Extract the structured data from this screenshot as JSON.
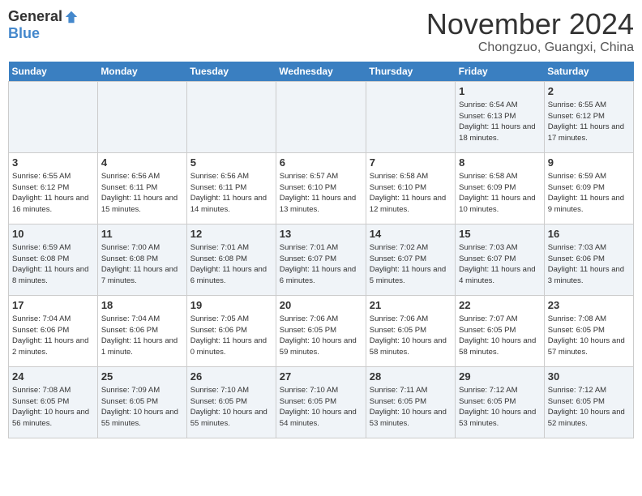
{
  "header": {
    "logo_general": "General",
    "logo_blue": "Blue",
    "month": "November 2024",
    "location": "Chongzuo, Guangxi, China"
  },
  "weekdays": [
    "Sunday",
    "Monday",
    "Tuesday",
    "Wednesday",
    "Thursday",
    "Friday",
    "Saturday"
  ],
  "weeks": [
    [
      {
        "day": "",
        "info": ""
      },
      {
        "day": "",
        "info": ""
      },
      {
        "day": "",
        "info": ""
      },
      {
        "day": "",
        "info": ""
      },
      {
        "day": "",
        "info": ""
      },
      {
        "day": "1",
        "info": "Sunrise: 6:54 AM\nSunset: 6:13 PM\nDaylight: 11 hours and 18 minutes."
      },
      {
        "day": "2",
        "info": "Sunrise: 6:55 AM\nSunset: 6:12 PM\nDaylight: 11 hours and 17 minutes."
      }
    ],
    [
      {
        "day": "3",
        "info": "Sunrise: 6:55 AM\nSunset: 6:12 PM\nDaylight: 11 hours and 16 minutes."
      },
      {
        "day": "4",
        "info": "Sunrise: 6:56 AM\nSunset: 6:11 PM\nDaylight: 11 hours and 15 minutes."
      },
      {
        "day": "5",
        "info": "Sunrise: 6:56 AM\nSunset: 6:11 PM\nDaylight: 11 hours and 14 minutes."
      },
      {
        "day": "6",
        "info": "Sunrise: 6:57 AM\nSunset: 6:10 PM\nDaylight: 11 hours and 13 minutes."
      },
      {
        "day": "7",
        "info": "Sunrise: 6:58 AM\nSunset: 6:10 PM\nDaylight: 11 hours and 12 minutes."
      },
      {
        "day": "8",
        "info": "Sunrise: 6:58 AM\nSunset: 6:09 PM\nDaylight: 11 hours and 10 minutes."
      },
      {
        "day": "9",
        "info": "Sunrise: 6:59 AM\nSunset: 6:09 PM\nDaylight: 11 hours and 9 minutes."
      }
    ],
    [
      {
        "day": "10",
        "info": "Sunrise: 6:59 AM\nSunset: 6:08 PM\nDaylight: 11 hours and 8 minutes."
      },
      {
        "day": "11",
        "info": "Sunrise: 7:00 AM\nSunset: 6:08 PM\nDaylight: 11 hours and 7 minutes."
      },
      {
        "day": "12",
        "info": "Sunrise: 7:01 AM\nSunset: 6:08 PM\nDaylight: 11 hours and 6 minutes."
      },
      {
        "day": "13",
        "info": "Sunrise: 7:01 AM\nSunset: 6:07 PM\nDaylight: 11 hours and 6 minutes."
      },
      {
        "day": "14",
        "info": "Sunrise: 7:02 AM\nSunset: 6:07 PM\nDaylight: 11 hours and 5 minutes."
      },
      {
        "day": "15",
        "info": "Sunrise: 7:03 AM\nSunset: 6:07 PM\nDaylight: 11 hours and 4 minutes."
      },
      {
        "day": "16",
        "info": "Sunrise: 7:03 AM\nSunset: 6:06 PM\nDaylight: 11 hours and 3 minutes."
      }
    ],
    [
      {
        "day": "17",
        "info": "Sunrise: 7:04 AM\nSunset: 6:06 PM\nDaylight: 11 hours and 2 minutes."
      },
      {
        "day": "18",
        "info": "Sunrise: 7:04 AM\nSunset: 6:06 PM\nDaylight: 11 hours and 1 minute."
      },
      {
        "day": "19",
        "info": "Sunrise: 7:05 AM\nSunset: 6:06 PM\nDaylight: 11 hours and 0 minutes."
      },
      {
        "day": "20",
        "info": "Sunrise: 7:06 AM\nSunset: 6:05 PM\nDaylight: 10 hours and 59 minutes."
      },
      {
        "day": "21",
        "info": "Sunrise: 7:06 AM\nSunset: 6:05 PM\nDaylight: 10 hours and 58 minutes."
      },
      {
        "day": "22",
        "info": "Sunrise: 7:07 AM\nSunset: 6:05 PM\nDaylight: 10 hours and 58 minutes."
      },
      {
        "day": "23",
        "info": "Sunrise: 7:08 AM\nSunset: 6:05 PM\nDaylight: 10 hours and 57 minutes."
      }
    ],
    [
      {
        "day": "24",
        "info": "Sunrise: 7:08 AM\nSunset: 6:05 PM\nDaylight: 10 hours and 56 minutes."
      },
      {
        "day": "25",
        "info": "Sunrise: 7:09 AM\nSunset: 6:05 PM\nDaylight: 10 hours and 55 minutes."
      },
      {
        "day": "26",
        "info": "Sunrise: 7:10 AM\nSunset: 6:05 PM\nDaylight: 10 hours and 55 minutes."
      },
      {
        "day": "27",
        "info": "Sunrise: 7:10 AM\nSunset: 6:05 PM\nDaylight: 10 hours and 54 minutes."
      },
      {
        "day": "28",
        "info": "Sunrise: 7:11 AM\nSunset: 6:05 PM\nDaylight: 10 hours and 53 minutes."
      },
      {
        "day": "29",
        "info": "Sunrise: 7:12 AM\nSunset: 6:05 PM\nDaylight: 10 hours and 53 minutes."
      },
      {
        "day": "30",
        "info": "Sunrise: 7:12 AM\nSunset: 6:05 PM\nDaylight: 10 hours and 52 minutes."
      }
    ]
  ]
}
